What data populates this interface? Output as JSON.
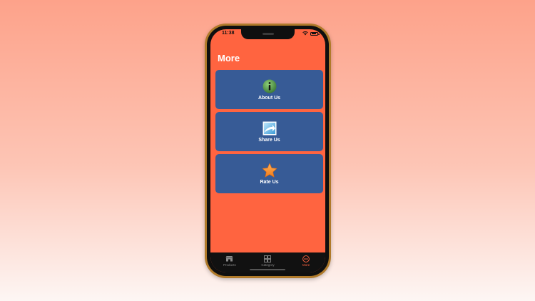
{
  "status_bar": {
    "time": "11:38",
    "battery_level": 0.85
  },
  "page": {
    "title": "More"
  },
  "menu_items": [
    {
      "label": "About Us",
      "icon": "info-icon"
    },
    {
      "label": "Share Us",
      "icon": "share-icon"
    },
    {
      "label": "Rate Us",
      "icon": "star-icon"
    }
  ],
  "tabs": [
    {
      "label": "Products",
      "icon": "products-icon",
      "active": false
    },
    {
      "label": "Category",
      "icon": "category-icon",
      "active": false
    },
    {
      "label": "More",
      "icon": "more-icon",
      "active": true
    }
  ],
  "colors": {
    "background_top": "#fda28a",
    "screen": "#ff6440",
    "card": "#375b96",
    "frame": "#b07a2a",
    "tab_active": "#ff6440",
    "tab_inactive": "#8a8a8a"
  }
}
